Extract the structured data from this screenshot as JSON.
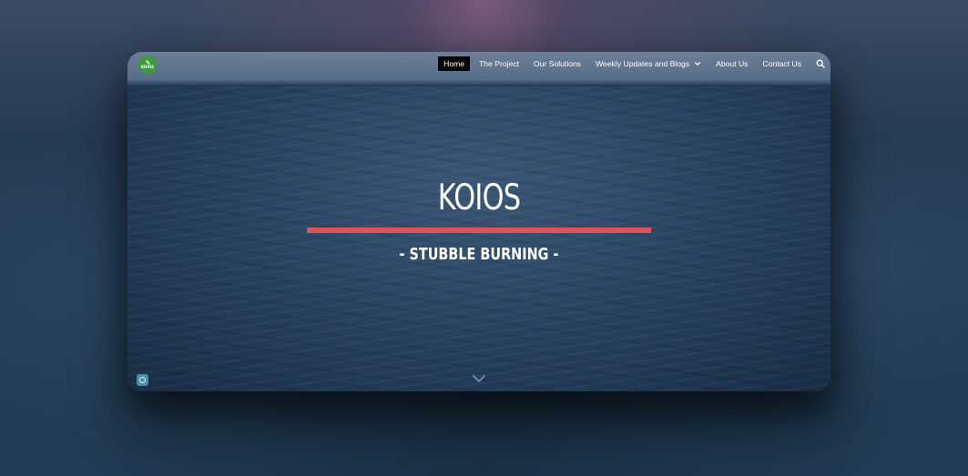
{
  "logo": {
    "text": "KOIOS"
  },
  "nav": {
    "items": [
      {
        "label": "Home",
        "active": true
      },
      {
        "label": "The Project",
        "active": false
      },
      {
        "label": "Our Solutions",
        "active": false
      },
      {
        "label": "Weekly Updates and Blogs",
        "active": false,
        "has_dropdown": true
      },
      {
        "label": "About Us",
        "active": false
      },
      {
        "label": "Contact Us",
        "active": false
      }
    ]
  },
  "hero": {
    "title": "KOIOS",
    "subtitle": "- STUBBLE BURNING -"
  },
  "colors": {
    "accent_underline": "#e4505a",
    "logo_green": "#3a9a3e",
    "active_nav_bg": "#000000"
  },
  "icons": {
    "search": "search-icon",
    "dropdown": "chevron-down-icon",
    "scroll": "scroll-down-icon",
    "info": "info-icon"
  }
}
